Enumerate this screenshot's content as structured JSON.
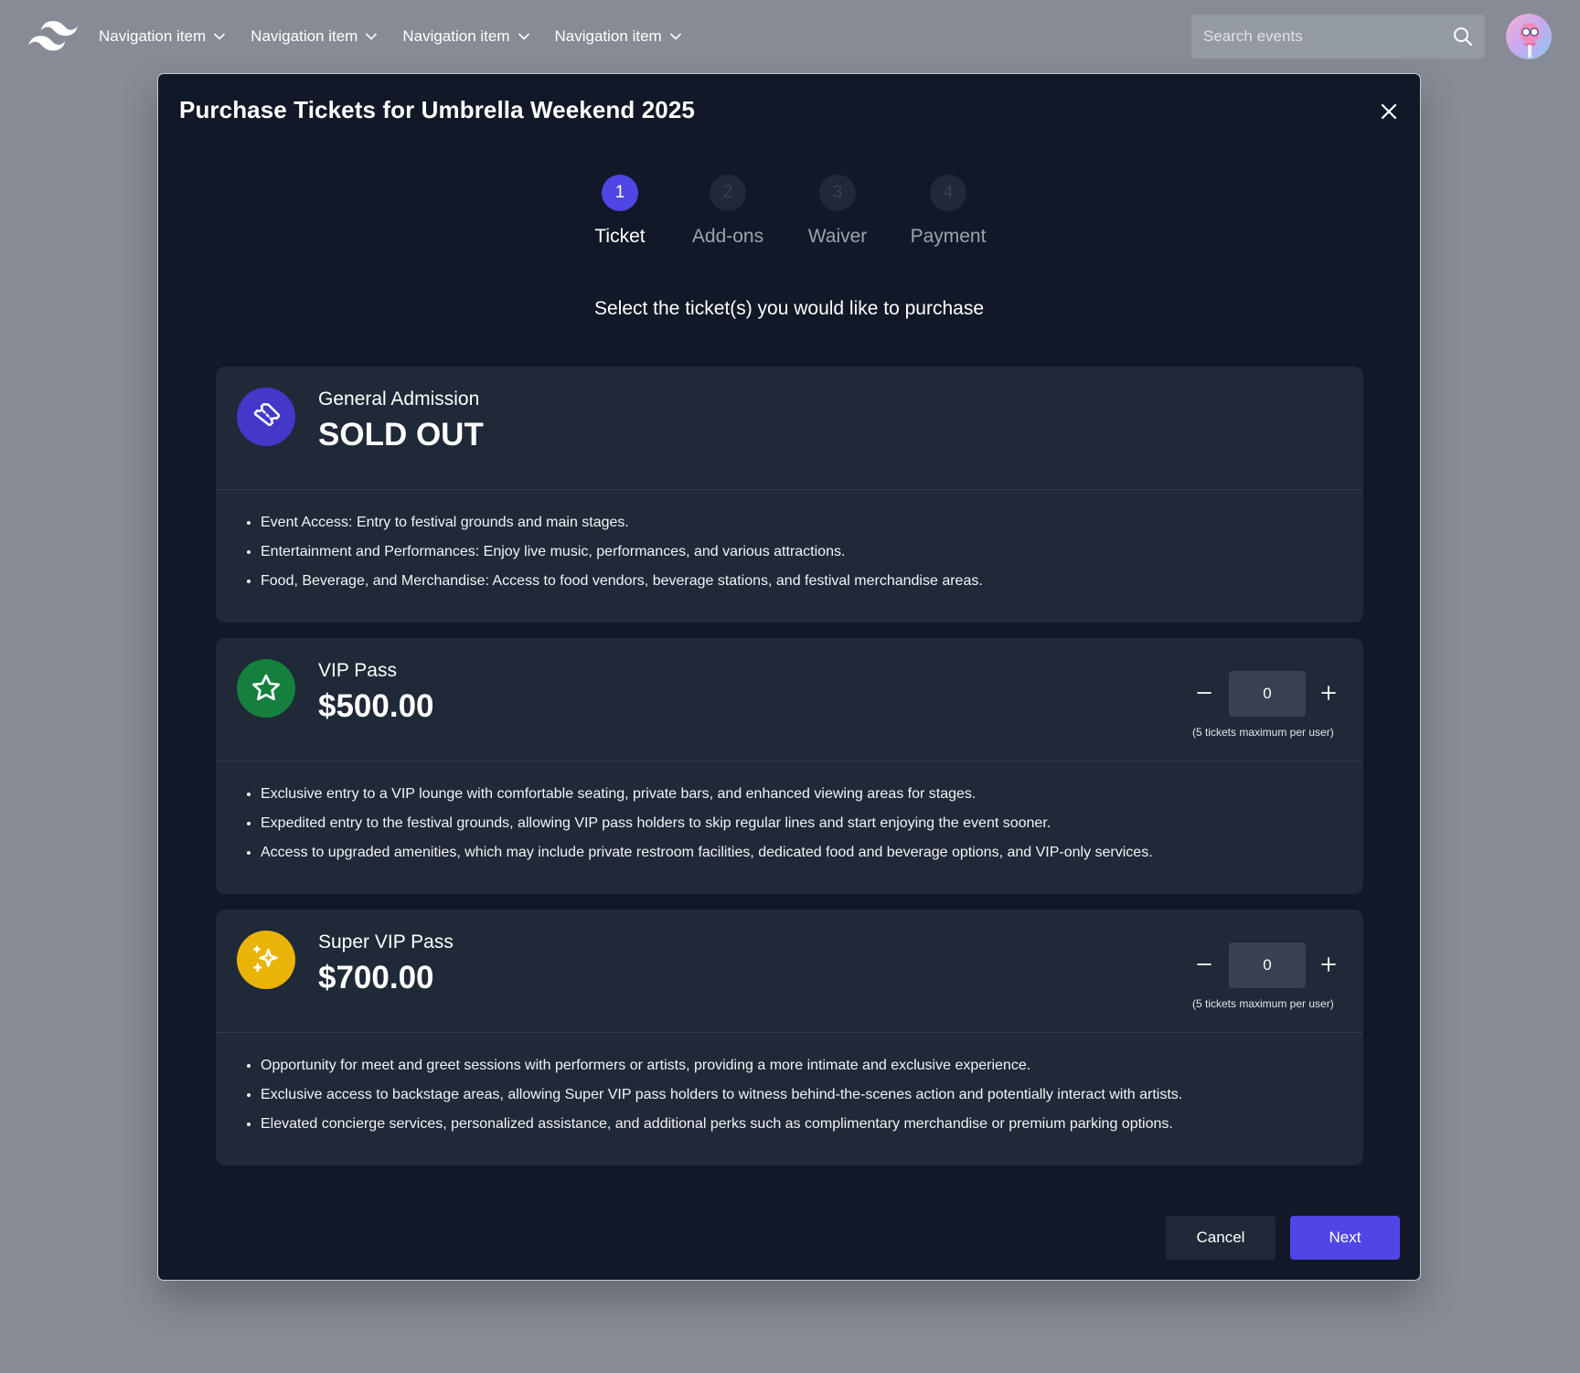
{
  "nav": {
    "logo_icon": "tailwind-waves-logo",
    "items": [
      {
        "label": "Navigation item"
      },
      {
        "label": "Navigation item"
      },
      {
        "label": "Navigation item"
      },
      {
        "label": "Navigation item"
      }
    ],
    "search_placeholder": "Search events"
  },
  "modal": {
    "title": "Purchase Tickets for Umbrella Weekend 2025",
    "steps": [
      {
        "number": "1",
        "label": "Ticket",
        "active": true
      },
      {
        "number": "2",
        "label": "Add-ons",
        "active": false
      },
      {
        "number": "3",
        "label": "Waiver",
        "active": false
      },
      {
        "number": "4",
        "label": "Payment",
        "active": false
      }
    ],
    "instruction": "Select the ticket(s) you would like to purchase",
    "tickets": [
      {
        "name": "General Admission",
        "price": "SOLD OUT",
        "icon": "ticket-icon",
        "icon_color": "#4338ca",
        "features": [
          "Event Access: Entry to festival grounds and main stages.",
          "Entertainment and Performances: Enjoy live music, performances, and various attractions.",
          "Food, Beverage, and Merchandise: Access to food vendors, beverage stations, and festival merchandise areas."
        ]
      },
      {
        "name": "VIP Pass",
        "price": "$500.00",
        "icon": "star-icon",
        "icon_color": "#15803d",
        "quantity": "0",
        "limit_note": "(5 tickets maximum per user)",
        "features": [
          "Exclusive entry to a VIP lounge with comfortable seating, private bars, and enhanced viewing areas for stages.",
          "Expedited entry to the festival grounds, allowing VIP pass holders to skip regular lines and start enjoying the event sooner.",
          "Access to upgraded amenities, which may include private restroom facilities, dedicated food and beverage options, and VIP-only services."
        ]
      },
      {
        "name": "Super VIP Pass",
        "price": "$700.00",
        "icon": "sparkles-icon",
        "icon_color": "#eab308",
        "quantity": "0",
        "limit_note": "(5 tickets maximum per user)",
        "features": [
          "Opportunity for meet and greet sessions with performers or artists, providing a more intimate and exclusive experience.",
          "Exclusive access to backstage areas, allowing Super VIP pass holders to witness behind-the-scenes action and potentially interact with artists.",
          "Elevated concierge services, personalized assistance, and additional perks such as complimentary merchandise or premium parking options."
        ]
      }
    ],
    "cancel_label": "Cancel",
    "next_label": "Next"
  },
  "colors": {
    "backdrop": "#878b95",
    "modal_bg": "#111827",
    "card_bg": "#1f2937",
    "accent": "#4f46e5"
  }
}
